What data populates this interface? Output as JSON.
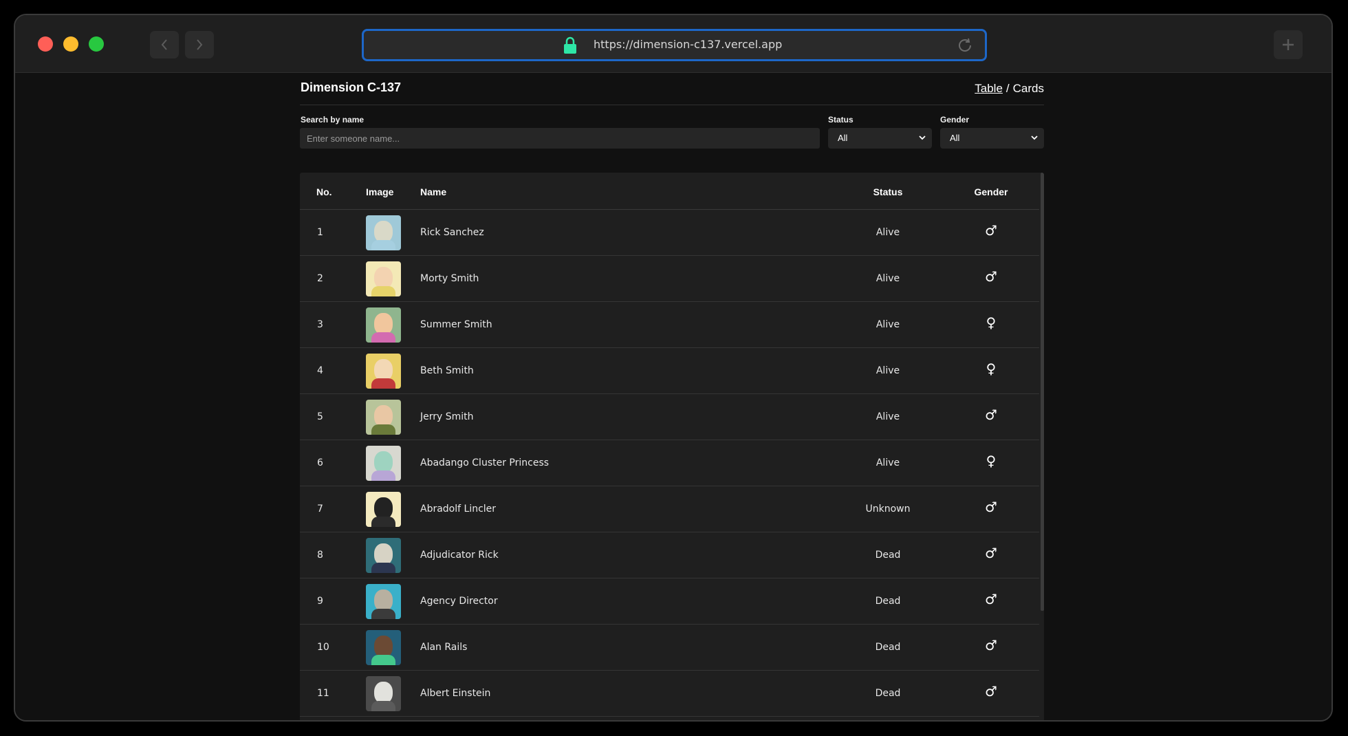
{
  "browser": {
    "url": "https://dimension-c137.vercel.app"
  },
  "header": {
    "title": "Dimension C-137",
    "view_table": "Table",
    "view_sep": "/",
    "view_cards": "Cards"
  },
  "filters": {
    "search_label": "Search by name",
    "search_placeholder": "Enter someone name...",
    "search_value": "",
    "status_label": "Status",
    "status_value": "All",
    "gender_label": "Gender",
    "gender_value": "All"
  },
  "table": {
    "columns": {
      "no": "No.",
      "image": "Image",
      "name": "Name",
      "status": "Status",
      "gender": "Gender"
    },
    "rows": [
      {
        "no": "1",
        "name": "Rick Sanchez",
        "status": "Alive",
        "gender": "♂",
        "gender_icon": "male-icon",
        "colors": {
          "bg": "#9fc9d8",
          "face": "#d9d9c8",
          "body": "#a6cfe0"
        }
      },
      {
        "no": "2",
        "name": "Morty Smith",
        "status": "Alive",
        "gender": "♂",
        "gender_icon": "male-icon",
        "colors": {
          "bg": "#f3e9b6",
          "face": "#f3d3b1",
          "body": "#e6d36a"
        }
      },
      {
        "no": "3",
        "name": "Summer Smith",
        "status": "Alive",
        "gender": "♀",
        "gender_icon": "female-icon",
        "colors": {
          "bg": "#8fb58e",
          "face": "#f1c69d",
          "body": "#d36bb0"
        }
      },
      {
        "no": "4",
        "name": "Beth Smith",
        "status": "Alive",
        "gender": "♀",
        "gender_icon": "female-icon",
        "colors": {
          "bg": "#e9cf66",
          "face": "#f3d8b5",
          "body": "#c23a3a"
        }
      },
      {
        "no": "5",
        "name": "Jerry Smith",
        "status": "Alive",
        "gender": "♂",
        "gender_icon": "male-icon",
        "colors": {
          "bg": "#b8c49a",
          "face": "#e9c7a4",
          "body": "#6a7a3a"
        }
      },
      {
        "no": "6",
        "name": "Abadango Cluster Princess",
        "status": "Alive",
        "gender": "♀",
        "gender_icon": "female-icon",
        "colors": {
          "bg": "#d8d8d0",
          "face": "#9ed3c0",
          "body": "#b8a6d6"
        }
      },
      {
        "no": "7",
        "name": "Abradolf Lincler",
        "status": "Unknown",
        "gender": "♂",
        "gender_icon": "male-icon",
        "colors": {
          "bg": "#f4eabf",
          "face": "#222222",
          "body": "#2b2b2b"
        }
      },
      {
        "no": "8",
        "name": "Adjudicator Rick",
        "status": "Dead",
        "gender": "♂",
        "gender_icon": "male-icon",
        "colors": {
          "bg": "#2f6d78",
          "face": "#d7d3c5",
          "body": "#2c3650"
        }
      },
      {
        "no": "9",
        "name": "Agency Director",
        "status": "Dead",
        "gender": "♂",
        "gender_icon": "male-icon",
        "colors": {
          "bg": "#3ab0c9",
          "face": "#b8b0a0",
          "body": "#3b3b3b"
        }
      },
      {
        "no": "10",
        "name": "Alan Rails",
        "status": "Dead",
        "gender": "♂",
        "gender_icon": "male-icon",
        "colors": {
          "bg": "#245f7a",
          "face": "#6b4a34",
          "body": "#44c98c"
        }
      },
      {
        "no": "11",
        "name": "Albert Einstein",
        "status": "Dead",
        "gender": "♂",
        "gender_icon": "male-icon",
        "colors": {
          "bg": "#4b4b4b",
          "face": "#e2e2dd",
          "body": "#5b5b5b"
        }
      },
      {
        "no": "",
        "name": "",
        "status": "",
        "gender": "♂",
        "gender_icon": "male-icon",
        "colors": {
          "bg": "#b89c96",
          "face": "#d9c0ba",
          "body": "#a07f78"
        }
      }
    ]
  },
  "colors": {
    "url_focus": "#1d67c8",
    "lock": "#2ee6a6",
    "close": "#ff5f57",
    "minimize": "#febc2e",
    "maximize": "#28c840"
  }
}
